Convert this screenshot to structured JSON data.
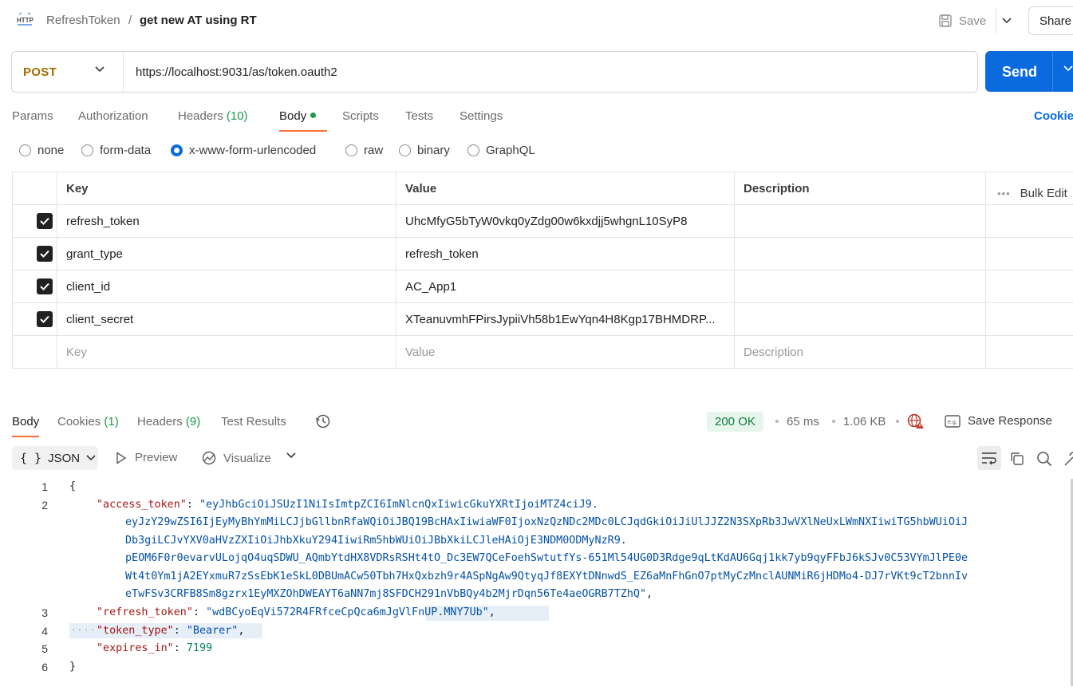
{
  "header": {
    "parent": "RefreshToken",
    "separator": "/",
    "title": "get new AT using RT",
    "save_label": "Save",
    "share_label": "Share"
  },
  "request": {
    "method": "POST",
    "url": "https://localhost:9031/as/token.oauth2",
    "send_label": "Send"
  },
  "req_tabs": [
    {
      "label": "Params"
    },
    {
      "label": "Authorization"
    },
    {
      "label": "Headers",
      "count": "(10)"
    },
    {
      "label": "Body"
    },
    {
      "label": "Scripts"
    },
    {
      "label": "Tests"
    },
    {
      "label": "Settings"
    }
  ],
  "cookies_label": "Cookie",
  "body_types": [
    "none",
    "form-data",
    "x-www-form-urlencoded",
    "raw",
    "binary",
    "GraphQL"
  ],
  "params": {
    "headers": [
      "Key",
      "Value",
      "Description"
    ],
    "bulk_edit": "Bulk Edit",
    "rows": [
      {
        "key": "refresh_token",
        "value": "UhcMfyG5bTyW0vkq0yZdg00w6kxdjj5whgnL10SyP8"
      },
      {
        "key": "grant_type",
        "value": "refresh_token"
      },
      {
        "key": "client_id",
        "value": "AC_App1"
      },
      {
        "key": "client_secret",
        "value": "XTeanuvmhFPirsJypiiVh58b1EwYqn4H8Kgp17BHMDRP..."
      }
    ],
    "placeholder": {
      "key": "Key",
      "value": "Value",
      "description": "Description"
    }
  },
  "response": {
    "tabs": [
      {
        "label": "Body"
      },
      {
        "label": "Cookies",
        "count": "(1)"
      },
      {
        "label": "Headers",
        "count": "(9)"
      },
      {
        "label": "Test Results"
      }
    ],
    "status": "200 OK",
    "time": "65 ms",
    "size": "1.06 KB",
    "save_response": "Save Response",
    "format": "JSON",
    "preview": "Preview",
    "visualize": "Visualize"
  },
  "code": {
    "line_numbers": [
      "1",
      "2",
      "3",
      "4",
      "5",
      "6"
    ],
    "open": "{",
    "close": "}",
    "access_token_key": "\"access_token\"",
    "access_token_parts": [
      "\"eyJhbGciOiJSUzI1NiIsImtpZCI6ImNlcnQxIiwicGkuYXRtIjoiMTZ4ciJ9.",
      "eyJzY29wZSI6IjEyMyBhYmMiLCJjbGllbnRfaWQiOiJBQ19BcHAxIiwiaWF0IjoxNzQzNDc2MDc0LCJqdGkiOiJiUlJJZ2N3SXpRb3JwVXlNeUxLWmNXIiwiTG5hbWUiOiJ",
      "Db3giLCJvYXV0aHVzZXIiOiJhbXkuY294IiwiRm5hbWUiOiJBbXkiLCJleHAiOjE3NDM0ODMyNzR9.",
      "pEOM6F0r0evarvULojqO4uqSDWU_AQmbYtdHX8VDRsRSHt4tO_Dc3EW7QCeFoehSwtutfYs-651Ml54UG0D3Rdge9qLtKdAU6Gqj1kk7yb9qyFFbJ6kSJv0C53VYmJlPE0e",
      "Wt4t0Ym1jA2EYxmuR7zSsEbK1eSkL0DBUmACw50Tbh7HxQxbzh9r4ASpNgAw9QtyqJf8EXYtDNnwdS_EZ6aMnFhGnO7ptMyCzMnclAUNMiR6jHDMo4-DJ7rVKt9cT2bnnIv",
      "eTwFSv3CRFB8Sm8gzrx1EyMXZOhDWEAYT6aNN7mj8SFDCH291nVbBQy4b2MjrDqn56Te4aeOGRB7TZhQ\""
    ],
    "refresh_token_key": "\"refresh_token\"",
    "refresh_token_value": "\"wdBCyoEqVi572R4FRfceCpQca6mJgVlFnUP.MNY7Ub\"",
    "token_type_key": "\"token_type\"",
    "token_type_value": "\"Bearer\"",
    "expires_in_key": "\"expires_in\"",
    "expires_in_value": "7199"
  }
}
